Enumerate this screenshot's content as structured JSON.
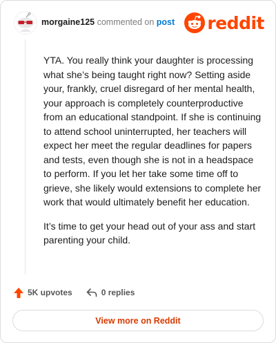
{
  "header": {
    "author": "morgaine125",
    "action_text": "commented on",
    "post_link": "post",
    "brand": "reddit"
  },
  "comment": {
    "paragraphs": [
      "YTA. You really think your daughter is processing what she’s being taught right now? Setting aside your, frankly, cruel disregard of her mental health, your approach is completely counterproductive from an educational standpoint. If she is continuing to attend school uninterrupted, her teachers will expect her meet the regular deadlines for papers and tests, even though she is not in a headspace to perform. If you let her take some time off to grieve, she likely would extensions to complete her work that would ultimately benefit her education.",
      "It’s time to get your head out of your ass and start parenting your child."
    ]
  },
  "actions": {
    "upvotes": "5K upvotes",
    "replies": "0 replies"
  },
  "footer": {
    "view_more": "View more on Reddit"
  },
  "colors": {
    "brand_orange": "#ff4500",
    "link_blue": "#0079d3",
    "button_text": "#d93a00"
  },
  "icons": {
    "avatar": "snoo-avatar-with-glasses",
    "logo": "reddit-snoo-icon",
    "upvote": "upvote-arrow-icon",
    "reply": "reply-arrow-icon"
  }
}
